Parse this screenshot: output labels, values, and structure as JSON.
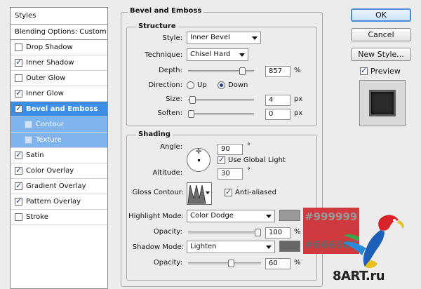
{
  "styles_panel": {
    "header": "Styles",
    "blending": "Blending Options: Custom",
    "items": [
      {
        "label": "Drop Shadow",
        "checked": false
      },
      {
        "label": "Inner Shadow",
        "checked": true
      },
      {
        "label": "Outer Glow",
        "checked": false
      },
      {
        "label": "Inner Glow",
        "checked": true
      },
      {
        "label": "Bevel and Emboss",
        "checked": true
      },
      {
        "label": "Contour",
        "checked": false
      },
      {
        "label": "Texture",
        "checked": false
      },
      {
        "label": "Satin",
        "checked": true
      },
      {
        "label": "Color Overlay",
        "checked": true
      },
      {
        "label": "Gradient Overlay",
        "checked": true
      },
      {
        "label": "Pattern Overlay",
        "checked": true
      },
      {
        "label": "Stroke",
        "checked": false
      }
    ]
  },
  "bevel": {
    "title": "Bevel and Emboss",
    "structure": {
      "title": "Structure",
      "style_label": "Style:",
      "style_value": "Inner Bevel",
      "technique_label": "Technique:",
      "technique_value": "Chisel Hard",
      "depth_label": "Depth:",
      "depth_value": "857",
      "depth_unit": "%",
      "depth_fraction": 0.86,
      "direction_label": "Direction:",
      "up_label": "Up",
      "down_label": "Down",
      "direction": "Down",
      "size_label": "Size:",
      "size_value": "4",
      "size_unit": "px",
      "size_fraction": 0.02,
      "soften_label": "Soften:",
      "soften_value": "0",
      "soften_unit": "px",
      "soften_fraction": 0.0
    },
    "shading": {
      "title": "Shading",
      "angle_label": "Angle:",
      "angle_value": "90",
      "angle_unit": "°",
      "global_light_label": "Use Global Light",
      "global_light": true,
      "altitude_label": "Altitude:",
      "altitude_value": "30",
      "altitude_unit": "°",
      "gloss_label": "Gloss Contour:",
      "antialiased_label": "Anti-aliased",
      "antialiased": true,
      "highlight_label": "Highlight Mode:",
      "highlight_value": "Color Dodge",
      "highlight_color": "#999999",
      "opacity_label": "Opacity:",
      "highlight_opacity": "100",
      "highlight_opacity_fraction": 1.0,
      "shadow_label": "Shadow Mode:",
      "shadow_value": "Lighten",
      "shadow_color": "#666666",
      "shadow_opacity": "60",
      "shadow_opacity_fraction": 0.6,
      "percent": "%"
    }
  },
  "buttons": {
    "ok": "OK",
    "cancel": "Cancel",
    "new_style": "New Style...",
    "preview": "Preview",
    "preview_checked": true
  },
  "overlay": {
    "color1": "#999999",
    "color2": "#666666",
    "watermark": "8ART.ru"
  }
}
